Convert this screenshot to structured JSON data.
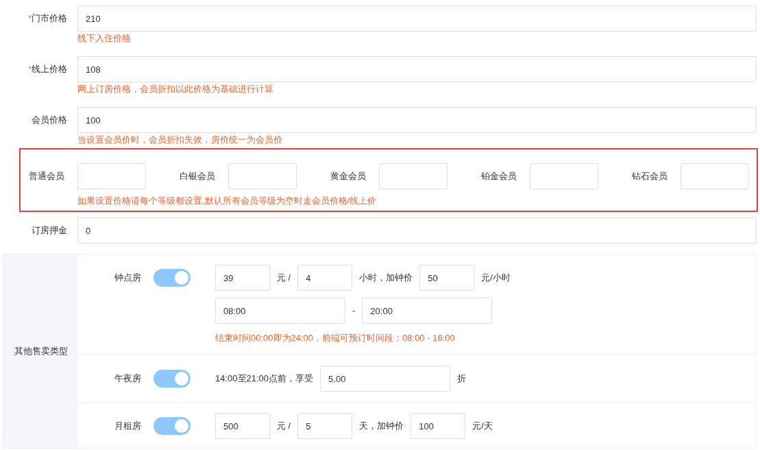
{
  "price_fields": [
    {
      "mark": "*",
      "label": "门市价格",
      "value": "210",
      "hint": "线下入住价格"
    },
    {
      "mark": "*",
      "label": "线上价格",
      "value": "108",
      "hint": "网上订房价格，会员折扣以此价格为基础进行计算"
    },
    {
      "label": "会员价格",
      "value": "100",
      "hint": "当设置会员价时，会员折扣失效，房价统一为会员价"
    }
  ],
  "member_levels": {
    "fields": [
      {
        "label": "普通会员"
      },
      {
        "label": "白银会员"
      },
      {
        "label": "黄金会员"
      },
      {
        "label": "铂金会员"
      },
      {
        "label": "钻石会员"
      }
    ],
    "hint": "如果设置价格请每个等级都设置,默认所有会员等级为空时走会员价格/线上价"
  },
  "deposit": {
    "label": "订房押金",
    "value": "0"
  },
  "other_sales": {
    "label": "其他售卖类型",
    "rows": [
      {
        "name": "钟点房",
        "on": true,
        "lines": [
          [
            {
              "kind": "input",
              "value": "39"
            },
            {
              "kind": "text",
              "text": "元 /"
            },
            {
              "kind": "input",
              "value": "4"
            },
            {
              "kind": "text",
              "text": "小时，加钟价"
            },
            {
              "kind": "input",
              "value": "50"
            },
            {
              "kind": "text",
              "text": "元/小时"
            }
          ],
          [
            {
              "kind": "wide-input",
              "value": "08:00"
            },
            {
              "kind": "text",
              "text": "-"
            },
            {
              "kind": "wide-input",
              "value": "20:00"
            }
          ]
        ],
        "hint": "结束时间00:00即为24:00，前端可预订时间段：08:00 - 16:00"
      },
      {
        "name": "午夜房",
        "on": true,
        "lines": [
          [
            {
              "kind": "text",
              "text": "14:00至21:00点前，享受"
            },
            {
              "kind": "wide-input",
              "value": "5.00"
            },
            {
              "kind": "text",
              "text": "折"
            }
          ]
        ]
      },
      {
        "name": "月租房",
        "on": true,
        "lines": [
          [
            {
              "kind": "input",
              "value": "500"
            },
            {
              "kind": "text",
              "text": "元 /"
            },
            {
              "kind": "input",
              "value": "5"
            },
            {
              "kind": "text",
              "text": "天，加钟价"
            },
            {
              "kind": "input",
              "value": "100"
            },
            {
              "kind": "text",
              "text": "元/天"
            }
          ]
        ]
      }
    ]
  }
}
